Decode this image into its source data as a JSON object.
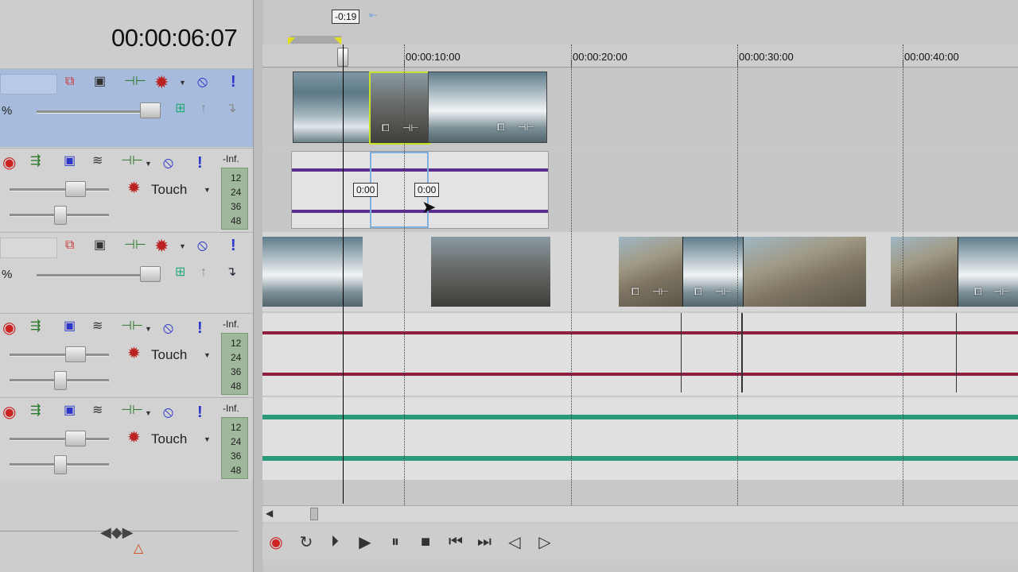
{
  "timecode": "00:00:06:07",
  "ruler": {
    "labels": [
      "00:00:10:00",
      "00:00:20:00",
      "00:00:30:00",
      "00:00:40:00"
    ],
    "offset_badge": "-0:19"
  },
  "tracks": [
    {
      "kind": "video",
      "percent_label": "%"
    },
    {
      "kind": "audio",
      "mode": "Touch",
      "level_top": "-Inf.",
      "meter_scale": [
        "12",
        "24",
        "36",
        "48"
      ],
      "fade_labels": [
        "0:00",
        "0:00"
      ]
    },
    {
      "kind": "video",
      "percent_label": "%"
    },
    {
      "kind": "audio",
      "mode": "Touch",
      "level_top": "-Inf.",
      "meter_scale": [
        "12",
        "24",
        "36",
        "48"
      ]
    },
    {
      "kind": "audio",
      "mode": "Touch",
      "level_top": "-Inf.",
      "meter_scale": [
        "12",
        "24",
        "36",
        "48"
      ]
    }
  ],
  "icons": {
    "record": "record-icon",
    "loop": "loop-icon",
    "play_from_start": "play-from-start-icon",
    "play": "play-icon",
    "pause": "pause-icon",
    "stop": "stop-icon",
    "prev": "go-to-start-icon",
    "next": "go-to-end-icon",
    "prev_frame": "previous-frame-icon",
    "next_frame": "next-frame-icon"
  },
  "colors": {
    "selected_track": "#a7bcdc",
    "audio_wave_1": "#5b2d8e",
    "audio_wave_2": "#8e1f3f",
    "audio_wave_3": "#2a9a7a",
    "accent_green": "#c8e22a"
  }
}
